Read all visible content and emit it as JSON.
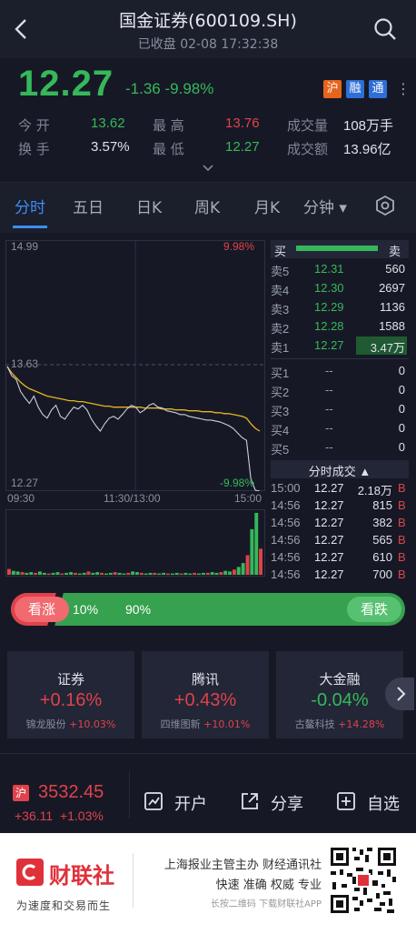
{
  "header": {
    "title": "国金证券(600109.SH)",
    "subtitle": "已收盘 02-08 17:32:38"
  },
  "quote": {
    "price": "12.27",
    "change": "-1.36",
    "change_pct": "-9.98%",
    "badges": [
      "沪",
      "融",
      "通"
    ],
    "open_label": "今 开",
    "open": "13.62",
    "high_label": "最 高",
    "high": "13.76",
    "volume_label": "成交量",
    "volume": "108万手",
    "turnover_label": "换 手",
    "turnover": "3.57%",
    "low_label": "最 低",
    "low": "12.27",
    "amount_label": "成交额",
    "amount": "13.96亿"
  },
  "tabs": [
    "分时",
    "五日",
    "日K",
    "周K",
    "月K",
    "分钟 ▾"
  ],
  "chart": {
    "y_top": "14.99",
    "y_mid": "13.63",
    "y_bot": "12.27",
    "pct_top": "9.98%",
    "pct_bot": "-9.98%",
    "x_start": "09:30",
    "x_mid": "11:30/13:00",
    "x_end": "15:00",
    "price_series": [
      13.62,
      13.52,
      13.48,
      13.35,
      13.28,
      13.22,
      13.3,
      13.18,
      13.1,
      13.06,
      13.15,
      13.2,
      13.08,
      13.05,
      13.12,
      13.18,
      13.16,
      13.2,
      13.15,
      13.05,
      12.98,
      12.92,
      13.0,
      13.06,
      13.08,
      13.05,
      13.1,
      13.16,
      13.2,
      13.18,
      13.12,
      13.15,
      13.2,
      13.22,
      13.18,
      13.17,
      13.14,
      13.13,
      13.12,
      13.1,
      13.1,
      13.08,
      13.07,
      13.06,
      13.05,
      13.04,
      13.04,
      13.03,
      13.02,
      13.0,
      12.98,
      12.95,
      12.9,
      12.85,
      12.82,
      12.4,
      12.28,
      12.27
    ],
    "avg_series": [
      13.62,
      13.55,
      13.5,
      13.45,
      13.41,
      13.38,
      13.36,
      13.34,
      13.32,
      13.3,
      13.29,
      13.28,
      13.27,
      13.26,
      13.25,
      13.25,
      13.24,
      13.24,
      13.23,
      13.22,
      13.21,
      13.2,
      13.19,
      13.19,
      13.18,
      13.18,
      13.18,
      13.18,
      13.18,
      13.18,
      13.18,
      13.17,
      13.17,
      13.17,
      13.17,
      13.16,
      13.16,
      13.16,
      13.15,
      13.15,
      13.15,
      13.14,
      13.14,
      13.14,
      13.13,
      13.13,
      13.13,
      13.12,
      13.12,
      13.11,
      13.11,
      13.1,
      13.09,
      13.08,
      13.06,
      13.0,
      12.95,
      12.92
    ],
    "volume_series": [
      9,
      6,
      5,
      4,
      3,
      4,
      3,
      5,
      3,
      2,
      3,
      4,
      2,
      3,
      4,
      3,
      2,
      3,
      5,
      3,
      4,
      3,
      2,
      3,
      4,
      3,
      2,
      3,
      5,
      4,
      3,
      2,
      3,
      3,
      2,
      3,
      2,
      2,
      3,
      2,
      3,
      2,
      3,
      2,
      3,
      3,
      4,
      3,
      4,
      6,
      5,
      8,
      12,
      18,
      30,
      70,
      95,
      40
    ]
  },
  "orderbook": {
    "buy_tag": "买",
    "sell_tag": "卖",
    "asks": [
      {
        "label": "卖5",
        "price": "12.31",
        "qty": "560"
      },
      {
        "label": "卖4",
        "price": "12.30",
        "qty": "2697"
      },
      {
        "label": "卖3",
        "price": "12.29",
        "qty": "1136"
      },
      {
        "label": "卖2",
        "price": "12.28",
        "qty": "1588"
      },
      {
        "label": "卖1",
        "price": "12.27",
        "qty": "3.47万"
      }
    ],
    "bids": [
      {
        "label": "买1",
        "price": "--",
        "qty": "0"
      },
      {
        "label": "买2",
        "price": "--",
        "qty": "0"
      },
      {
        "label": "买3",
        "price": "--",
        "qty": "0"
      },
      {
        "label": "买4",
        "price": "--",
        "qty": "0"
      },
      {
        "label": "买5",
        "price": "--",
        "qty": "0"
      }
    ]
  },
  "trades": {
    "title": "分时成交 ▲",
    "rows": [
      {
        "time": "15:00",
        "price": "12.27",
        "qty": "2.18万",
        "side": "B"
      },
      {
        "time": "14:56",
        "price": "12.27",
        "qty": "815",
        "side": "B"
      },
      {
        "time": "14:56",
        "price": "12.27",
        "qty": "382",
        "side": "B"
      },
      {
        "time": "14:56",
        "price": "12.27",
        "qty": "565",
        "side": "B"
      },
      {
        "time": "14:56",
        "price": "12.27",
        "qty": "610",
        "side": "B"
      },
      {
        "time": "14:56",
        "price": "12.27",
        "qty": "700",
        "side": "B"
      }
    ]
  },
  "sentiment": {
    "up_label": "看涨",
    "up_pct": "10%",
    "down_pct": "90%",
    "down_label": "看跌",
    "up_fraction": 0.1
  },
  "sectors": [
    {
      "name": "证券",
      "change": "+0.16%",
      "stock": "锦龙股份",
      "stock_change": "+10.03%",
      "color": "#e0424b"
    },
    {
      "name": "腾讯",
      "change": "+0.43%",
      "stock": "四维图新",
      "stock_change": "+10.01%",
      "color": "#e0424b"
    },
    {
      "name": "大金融",
      "change": "-0.04%",
      "stock": "古鳌科技",
      "stock_change": "+14.28%",
      "color": "#36b85a"
    }
  ],
  "bottom": {
    "index_tag": "沪",
    "index_value": "3532.45",
    "index_change": "+36.11",
    "index_pct": "+1.03%",
    "open_account": "开户",
    "share": "分享",
    "watchlist": "自选"
  },
  "footer": {
    "brand": "财联社",
    "slogan": "为速度和交易而生",
    "line1": "上海报业主管主办 财经通讯社",
    "line2": "快速 准确 权威 专业",
    "line3": "长按二维码 下载财联社APP"
  },
  "colors": {
    "up": "#e0424b",
    "down": "#36b85a",
    "accent": "#3d8ef6",
    "price_line": "#c8d0e0",
    "avg_line": "#e6b422"
  }
}
